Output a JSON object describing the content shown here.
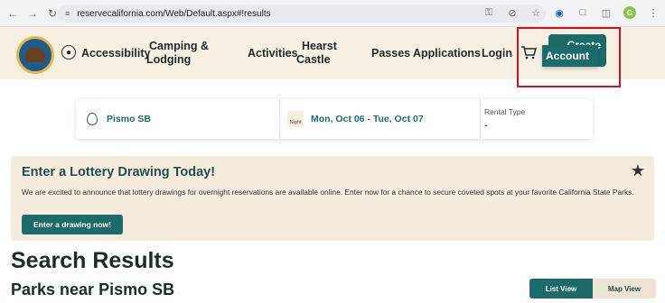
{
  "browser": {
    "url": "reservecalifornia.com/Web/Default.aspx#!results"
  },
  "header": {
    "nav": {
      "accessibility": "Accessibility",
      "camping_line1": "Camping &",
      "camping_line2": "Lodging",
      "activities": "Activities",
      "hearst_line1": "Hearst",
      "hearst_line2": "Castle",
      "passes": "Passes",
      "applications": "Applications",
      "login": "Login"
    },
    "create_label": "Create",
    "account_label": "Account",
    "logo_icon": "california-state-parks-logo",
    "highlight_color": "#d90e1e",
    "brand_color": "#1c6b6b"
  },
  "search": {
    "location": "Pismo SB",
    "night_badge": "Night",
    "dates": "Mon, Oct 06 - Tue, Oct 07",
    "rental_label": "Rental Type",
    "rental_value": "-"
  },
  "lottery": {
    "title": "Enter a Lottery Drawing Today!",
    "body": "We are excited to announce that lottery drawings for overnight reservations are available online. Enter now for a chance to secure coveted spots at your favorite California State Parks.",
    "button": "Enter a drawing now!"
  },
  "results": {
    "title": "Search Results",
    "subtitle": "Parks near Pismo SB",
    "list_view": "List View",
    "map_view": "Map View"
  }
}
